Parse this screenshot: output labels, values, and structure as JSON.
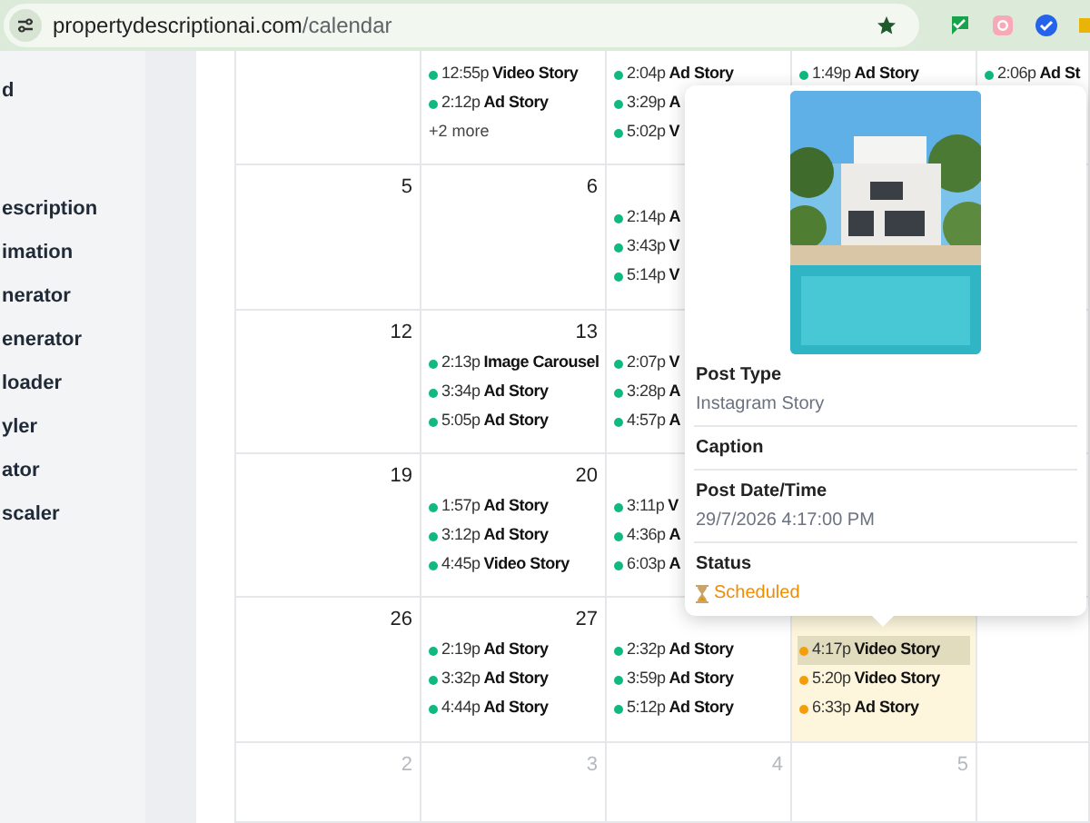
{
  "browser": {
    "url_host": "propertydescriptionai.com",
    "url_path": "/calendar",
    "bookmarked": true
  },
  "sidebar": {
    "items": [
      {
        "label": "d",
        "selected": false
      },
      {
        "label": "escription",
        "selected": false
      },
      {
        "label": "imation",
        "selected": false
      },
      {
        "label": "nerator",
        "selected": false
      },
      {
        "label": "enerator",
        "selected": false
      },
      {
        "label": "loader",
        "selected": false
      },
      {
        "label": "yler",
        "selected": false
      },
      {
        "label": "ator",
        "selected": false
      },
      {
        "label": "scaler",
        "selected": false
      }
    ]
  },
  "calendar": {
    "weeks": [
      {
        "days": [
          {
            "highlighted": false
          },
          {
            "events": [
              {
                "time": "12:55p",
                "title": "Video Story",
                "color": "#10b981",
                "selected": false
              },
              {
                "time": "2:12p",
                "title": "Ad Story",
                "color": "#10b981",
                "selected": false
              }
            ],
            "more": "+2 more"
          },
          {
            "events": [
              {
                "time": "2:04p",
                "title": "Ad Story",
                "color": "#10b981",
                "selected": false
              },
              {
                "time": "3:29p",
                "title": "A",
                "color": "#10b981",
                "selected": false
              },
              {
                "time": "5:02p",
                "title": "V",
                "color": "#10b981",
                "selected": false
              }
            ]
          },
          {
            "events": [
              {
                "time": "1:49p",
                "title": "Ad Story",
                "color": "#10b981",
                "selected": false
              }
            ]
          },
          {
            "events": [
              {
                "time": "2:06p",
                "title": "Ad St",
                "color": "#10b981",
                "selected": false
              }
            ]
          }
        ]
      },
      {
        "days": [
          {
            "day": "5",
            "muted": false
          },
          {
            "day": "6",
            "muted": false
          },
          {
            "events": [
              {
                "time": "2:14p",
                "title": "A",
                "color": "#10b981",
                "selected": false
              },
              {
                "time": "3:43p",
                "title": "V",
                "color": "#10b981",
                "selected": false
              },
              {
                "time": "5:14p",
                "title": "V",
                "color": "#10b981",
                "selected": false
              }
            ]
          }
        ]
      },
      {
        "days": [
          {
            "day": "12",
            "muted": false
          },
          {
            "day": "13",
            "muted": false,
            "events": [
              {
                "time": "2:13p",
                "title": "Image Carousel",
                "color": "#10b981",
                "selected": false
              },
              {
                "time": "3:34p",
                "title": "Ad Story",
                "color": "#10b981",
                "selected": false
              },
              {
                "time": "5:05p",
                "title": "Ad Story",
                "color": "#10b981",
                "selected": false
              }
            ]
          },
          {
            "events": [
              {
                "time": "2:07p",
                "title": "V",
                "color": "#10b981",
                "selected": false
              },
              {
                "time": "3:28p",
                "title": "A",
                "color": "#10b981",
                "selected": false
              },
              {
                "time": "4:57p",
                "title": "A",
                "color": "#10b981",
                "selected": false
              }
            ]
          }
        ]
      },
      {
        "days": [
          {
            "day": "19",
            "muted": false
          },
          {
            "day": "20",
            "muted": false,
            "events": [
              {
                "time": "1:57p",
                "title": "Ad Story",
                "color": "#10b981",
                "selected": false
              },
              {
                "time": "3:12p",
                "title": "Ad Story",
                "color": "#10b981",
                "selected": false
              },
              {
                "time": "4:45p",
                "title": "Video Story",
                "color": "#10b981",
                "selected": false
              }
            ]
          },
          {
            "events": [
              {
                "time": "3:11p",
                "title": "V",
                "color": "#10b981",
                "selected": false
              },
              {
                "time": "4:36p",
                "title": "A",
                "color": "#10b981",
                "selected": false
              },
              {
                "time": "6:03p",
                "title": "A",
                "color": "#10b981",
                "selected": false
              }
            ]
          }
        ]
      },
      {
        "days": [
          {
            "day": "26",
            "muted": false
          },
          {
            "day": "27",
            "muted": false,
            "events": [
              {
                "time": "2:19p",
                "title": "Ad Story",
                "color": "#10b981",
                "selected": false
              },
              {
                "time": "3:32p",
                "title": "Ad Story",
                "color": "#10b981",
                "selected": false
              },
              {
                "time": "4:44p",
                "title": "Ad Story",
                "color": "#10b981",
                "selected": false
              }
            ]
          },
          {
            "events": [
              {
                "time": "2:32p",
                "title": "Ad Story",
                "color": "#10b981",
                "selected": false
              },
              {
                "time": "3:59p",
                "title": "Ad Story",
                "color": "#10b981",
                "selected": false
              },
              {
                "time": "5:12p",
                "title": "Ad Story",
                "color": "#10b981",
                "selected": false
              }
            ]
          },
          {
            "highlighted": true,
            "events": [
              {
                "time": "4:17p",
                "title": "Video Story",
                "color": "#f59e0b",
                "selected": true
              },
              {
                "time": "5:20p",
                "title": "Video Story",
                "color": "#f59e0b",
                "selected": false
              },
              {
                "time": "6:33p",
                "title": "Ad Story",
                "color": "#f59e0b",
                "selected": false
              }
            ]
          },
          {
            "highlighted": false
          }
        ]
      },
      {
        "days": [
          {
            "day": "2",
            "muted": true
          },
          {
            "day": "3",
            "muted": true
          },
          {
            "day": "4",
            "muted": true
          },
          {
            "day": "5",
            "muted": true
          },
          {
            "highlighted": false
          }
        ]
      }
    ]
  },
  "popover": {
    "fields": [
      {
        "label": "Post Type",
        "value": "Instagram Story"
      },
      {
        "label": "Caption"
      },
      {
        "label": "Post Date/Time",
        "value": "29/7/2026 4:17:00 PM"
      },
      {
        "label": "Status",
        "value": "Scheduled",
        "kind": "status"
      }
    ]
  }
}
